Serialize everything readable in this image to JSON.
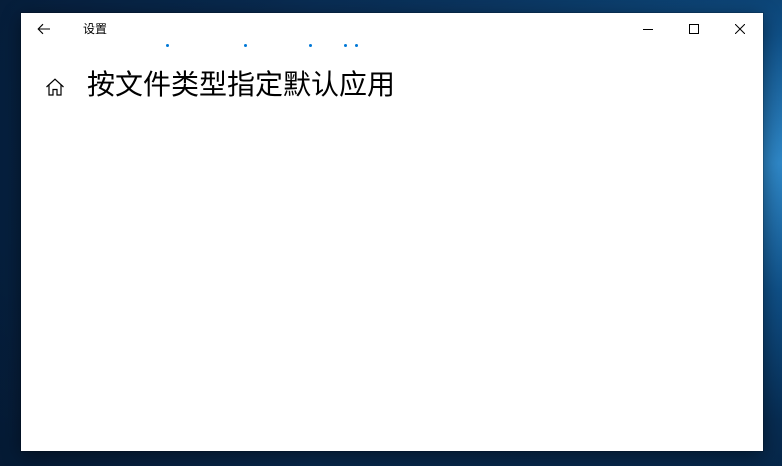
{
  "window": {
    "app_title": "设置"
  },
  "page": {
    "title": "按文件类型指定默认应用"
  },
  "icons": {
    "back": "back-arrow-icon",
    "home": "home-icon",
    "minimize": "minimize-icon",
    "maximize": "maximize-icon",
    "close": "close-icon"
  },
  "colors": {
    "accent": "#0078d7",
    "window_bg": "#ffffff",
    "text": "#000000"
  },
  "status": {
    "loading": true
  }
}
